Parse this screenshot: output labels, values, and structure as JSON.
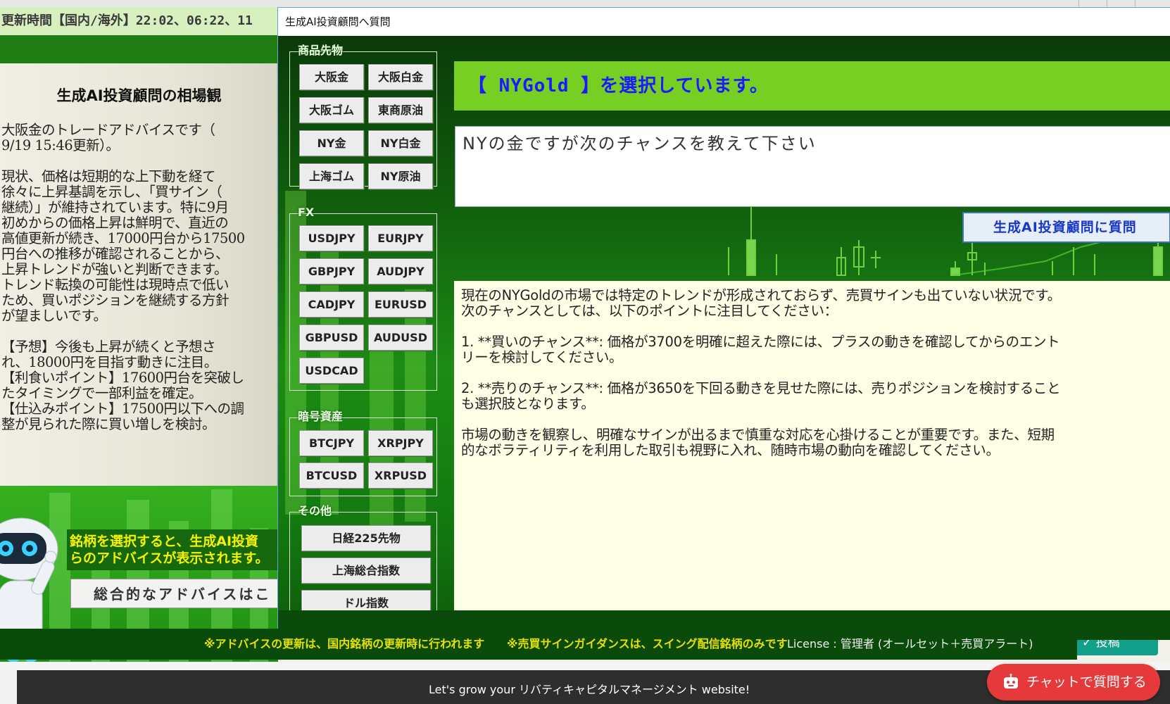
{
  "background_app": {
    "update_bar": "更新時間【国内/海外】22:02、06:22、11",
    "advice_title": "生成AI投資顧問の相場観",
    "advice_body": "大阪金のトレードアドバイスです（\n9/19 15:46更新）。\n\n現状、価格は短期的な上下動を経て\n徐々に上昇基調を示し、「買サイン（\n継続）」が維持されています。特に9月\n初めからの価格上昇は鮮明で、直近の\n高値更新が続き、17000円台から17500\n円台への推移が確認されることから、\n上昇トレンドが強いと判断できます。\nトレンド転換の可能性は現時点で低い\nため、買いポジションを継続する方針\nが望ましいです。\n\n【予想】今後も上昇が続くと予想さ\nれ、18000円を目指す動きに注目。\n【利食いポイント】17600円台を突破し\nたタイミングで一部利益を確定。\n【仕込みポイント】17500円以下への調\n整が見られた際に買い増しを検討。",
    "hint_text_1": "銘柄を選択すると、生成AI投資",
    "hint_text_2": "らのアドバイスが表示されます。",
    "overall_button": "総合的なアドバイスはこ",
    "post_button": "投稿"
  },
  "dialog": {
    "title": "生成AI投資顧問へ質問",
    "groups": [
      {
        "label": "商品先物",
        "buttons": [
          "大阪金",
          "大阪白金",
          "大阪ゴム",
          "東商原油",
          "NY金",
          "NY白金",
          "上海ゴム",
          "NY原油"
        ]
      },
      {
        "label": "FX",
        "buttons": [
          "USDJPY",
          "EURJPY",
          "GBPJPY",
          "AUDJPY",
          "CADJPY",
          "EURUSD",
          "GBPUSD",
          "AUDUSD",
          "USDCAD"
        ]
      },
      {
        "label": "暗号資産",
        "buttons": [
          "BTCJPY",
          "XRPJPY",
          "BTCUSD",
          "XRPUSD"
        ]
      },
      {
        "label": "その他",
        "buttons": [
          "日経225先物",
          "上海総合指数",
          "ドル指数"
        ]
      }
    ],
    "selection_banner": "【 NYGold 】を選択しています。",
    "question_value": "NYの金ですが次のチャンスを教えて下さい",
    "ask_button": "生成AI投資顧問に質問",
    "answer": "現在のNYGoldの市場では特定のトレンドが形成されておらず、売買サインも出ていない状況です。\n次のチャンスとしては、以下のポイントに注目してください：\n\n1. **買いのチャンス**: 価格が3700を明確に超えた際には、プラスの動きを確認してからのエント\nリーを検討してください。\n\n2. **売りのチャンス**: 価格が3650を下回る動きを見せた際には、売りポジションを検討すること\nも選択肢となります。\n\n市場の動きを観察し、明確なサインが出るまで慎重な対応を心掛けることが重要です。また、短期\n的なボラティリティを利用した取引も視野に入れ、随時市場の動向を確認してください。",
    "notice_1": "※アドバイスの更新は、国内銘柄の更新時に行われます",
    "notice_2": "※売買サインガイダンスは、スイング配信銘柄のみです",
    "license": "License : 管理者 (オールセット＋売買アラート)"
  },
  "site": {
    "banner_text": "Let's grow your リバティキャピタルマネージメント website!",
    "chat_button": "チャットで質問する"
  },
  "colors": {
    "selection_banner_bg": "#78cf24",
    "selection_banner_text": "#1a1aff",
    "notice_text": "#e6e000",
    "answer_bg": "#fefee6",
    "chat_button_bg": "#e5393b"
  }
}
